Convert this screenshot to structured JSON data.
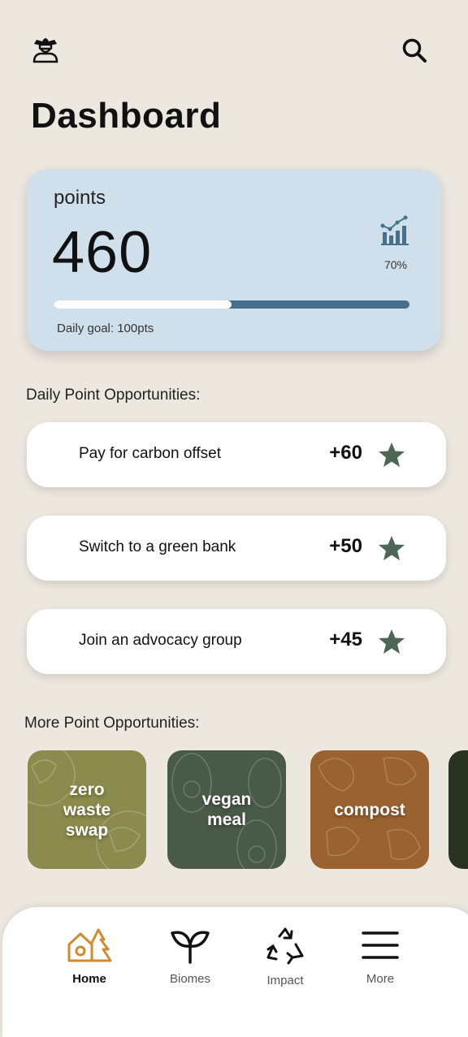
{
  "header": {
    "title": "Dashboard",
    "profile_icon": "cowboy-avatar-icon",
    "search_icon": "search-icon"
  },
  "points_card": {
    "label": "points",
    "value": "460",
    "trend_icon": "bar-chart-trend-icon",
    "trend_percent": "70%",
    "progress_fraction": 0.5,
    "daily_goal": "Daily goal: 100pts"
  },
  "daily": {
    "heading": "Daily Point Opportunities:",
    "items": [
      {
        "label": "Pay for carbon offset",
        "points": "+60",
        "icon": "star-icon"
      },
      {
        "label": "Switch to a green bank",
        "points": "+50",
        "icon": "star-icon"
      },
      {
        "label": "Join an advocacy group",
        "points": "+45",
        "icon": "star-icon"
      }
    ]
  },
  "more": {
    "heading": "More Point Opportunities:",
    "tiles": [
      {
        "label": "zero\nwaste\nswap",
        "color": "#8a8b4c"
      },
      {
        "label": "vegan\nmeal",
        "color": "#4a5a48"
      },
      {
        "label": "compost",
        "color": "#9a6230"
      },
      {
        "label": "",
        "color": "#2a3322"
      }
    ]
  },
  "nav": {
    "items": [
      {
        "label": "Home",
        "icon": "home-icon",
        "active": true
      },
      {
        "label": "Biomes",
        "icon": "sprout-icon",
        "active": false
      },
      {
        "label": "Impact",
        "icon": "recycle-icon",
        "active": false
      },
      {
        "label": "More",
        "icon": "menu-icon",
        "active": false
      }
    ],
    "accent": "#d08a30"
  }
}
